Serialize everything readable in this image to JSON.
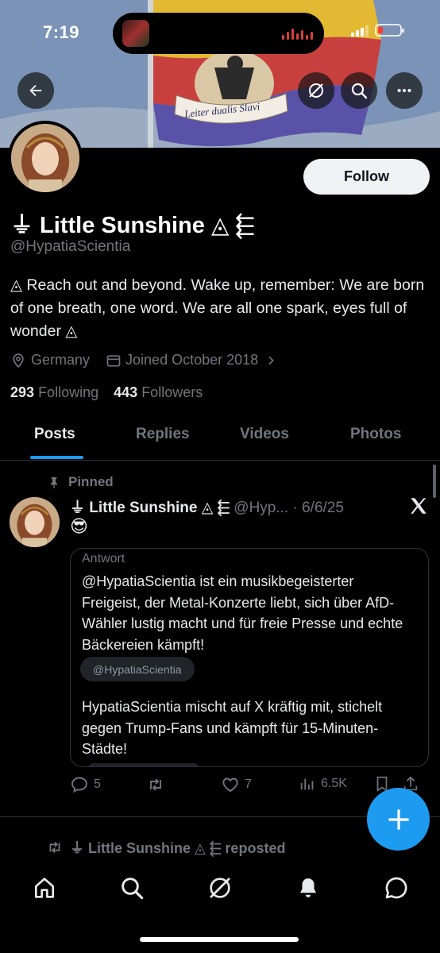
{
  "status_bar": {
    "time": "7:19"
  },
  "banner": {
    "flag_motto": "Leiter dualis Slavi"
  },
  "profile": {
    "follow_label": "Follow",
    "display_name": "⏚ Little Sunshine ◬ ⬱",
    "handle": "@HypatiaScientia",
    "bio": "◬ Reach out and beyond. Wake up, remember: We are born of one breath, one word. We are all one spark, eyes full of wonder ◬",
    "location": "Germany",
    "joined": "Joined October 2018",
    "following_count": "293",
    "following_label": "Following",
    "followers_count": "443",
    "followers_label": "Followers"
  },
  "tabs": [
    "Posts",
    "Replies",
    "Videos",
    "Photos"
  ],
  "active_tab": "Posts",
  "pinned_post": {
    "pinned_label": "Pinned",
    "author_name": "⏚ Little Sunshine ◬ ⬱",
    "author_handle_date": "@Hyp... · 6/6/25",
    "emoji": "😎",
    "quote": {
      "label": "Antwort",
      "paragraph1": "@HypatiaScientia ist ein musikbegeisterter Freigeist, der Metal-Konzerte liebt, sich über AfD-Wähler lustig macht und für freie Presse und echte Bäckereien kämpft!",
      "chip": "@HypatiaScientia",
      "paragraph2": "HypatiaScientia mischt auf X kräftig mit, stichelt gegen Trump-Fans und kämpft für 15-Minuten-Städte!"
    },
    "replies": "5",
    "reposts": "",
    "likes": "7",
    "views": "6.5K"
  },
  "next_post": {
    "reposted_label": "⏚ Little Sunshine ◬ ⬱ reposted"
  },
  "colors": {
    "accent": "#1d9bf0",
    "background": "#000000",
    "secondary_text": "#71767b"
  },
  "icons": [
    "back-arrow-icon",
    "grok-icon",
    "search-icon",
    "more-icon",
    "location-pin-icon",
    "calendar-icon",
    "pin-icon",
    "x-logo-icon",
    "reply-icon",
    "repost-icon",
    "like-icon",
    "views-icon",
    "bookmark-icon",
    "share-icon",
    "plus-icon",
    "home-icon",
    "notifications-icon",
    "messages-icon"
  ]
}
